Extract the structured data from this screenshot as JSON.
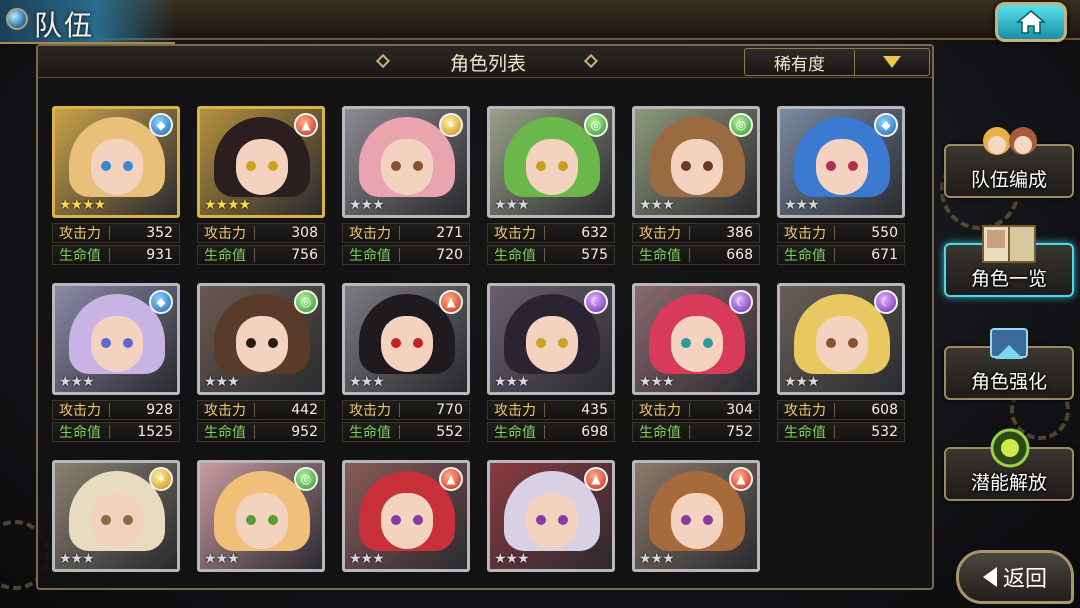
{
  "header": {
    "title": "队伍"
  },
  "panel": {
    "title": "角色列表",
    "sort_label": "稀有度"
  },
  "stat_labels": {
    "atk": "攻击力",
    "hp": "生命值"
  },
  "characters": [
    {
      "element": "water",
      "stars": "★★★★",
      "rarity": "gold",
      "atk": "352",
      "hp": "931",
      "hair": "#e8c07a",
      "bg": "#c9a24a",
      "eye": "#3a8ad0"
    },
    {
      "element": "fire",
      "stars": "★★★★",
      "rarity": "gold",
      "atk": "308",
      "hp": "756",
      "hair": "#2a1e1e",
      "bg": "#b4903e",
      "eye": "#d0a020"
    },
    {
      "element": "light",
      "stars": "★★★",
      "rarity": "silver",
      "atk": "271",
      "hp": "720",
      "hair": "#e9a4b0",
      "bg": "#8a8a90",
      "eye": "#8a5030"
    },
    {
      "element": "wind",
      "stars": "★★★",
      "rarity": "silver",
      "atk": "632",
      "hp": "575",
      "hair": "#6ab84a",
      "bg": "#9aa08a",
      "eye": "#c8a020"
    },
    {
      "element": "wind",
      "stars": "★★★",
      "rarity": "silver",
      "atk": "386",
      "hp": "668",
      "hair": "#9a6a40",
      "bg": "#8c9a7a",
      "eye": "#6a3a20"
    },
    {
      "element": "water",
      "stars": "★★★",
      "rarity": "silver",
      "atk": "550",
      "hp": "671",
      "hair": "#3a7ad0",
      "bg": "#7a8aa0",
      "eye": "#b03050"
    },
    {
      "element": "water",
      "stars": "★★★",
      "rarity": "silver",
      "atk": "928",
      "hp": "1525",
      "hair": "#c8b4e4",
      "bg": "#8a8aa8",
      "eye": "#5a6ad0"
    },
    {
      "element": "wind",
      "stars": "★★★",
      "rarity": "silver",
      "atk": "442",
      "hp": "952",
      "hair": "#5a3a28",
      "bg": "#6a5a50",
      "eye": "#2a1a10"
    },
    {
      "element": "fire",
      "stars": "★★★",
      "rarity": "silver",
      "atk": "770",
      "hp": "552",
      "hair": "#1e1a1e",
      "bg": "#7a7a80",
      "eye": "#c82020"
    },
    {
      "element": "dark",
      "stars": "★★★",
      "rarity": "silver",
      "atk": "435",
      "hp": "698",
      "hair": "#2a2430",
      "bg": "#6a6070",
      "eye": "#d0a020"
    },
    {
      "element": "dark",
      "stars": "★★★",
      "rarity": "silver",
      "atk": "304",
      "hp": "752",
      "hair": "#d83a5a",
      "bg": "#8a6a70",
      "eye": "#2a9a9a"
    },
    {
      "element": "dark",
      "stars": "★★★",
      "rarity": "silver",
      "atk": "608",
      "hp": "532",
      "hair": "#e8c860",
      "bg": "#6a6058",
      "eye": "#8a5030"
    },
    {
      "element": "light",
      "stars": "★★★",
      "rarity": "silver",
      "atk": "",
      "hp": "",
      "hair": "#e8dcc0",
      "bg": "#8a8070",
      "eye": "#8a6a40"
    },
    {
      "element": "wind",
      "stars": "★★★",
      "rarity": "silver",
      "atk": "",
      "hp": "",
      "hair": "#f0c07a",
      "bg": "#c89aa0",
      "eye": "#5a9a3a"
    },
    {
      "element": "fire",
      "stars": "★★★",
      "rarity": "silver",
      "atk": "",
      "hp": "",
      "hair": "#c8303a",
      "bg": "#8a5a5a",
      "eye": "#8a3aa0"
    },
    {
      "element": "fire",
      "stars": "★★★",
      "rarity": "silver",
      "atk": "",
      "hp": "",
      "hair": "#d8d0e4",
      "bg": "#8a3a40",
      "eye": "#8a3aa0"
    },
    {
      "element": "fire",
      "stars": "★★★",
      "rarity": "silver",
      "atk": "",
      "hp": "",
      "hair": "#a86a3a",
      "bg": "#8a7a6a",
      "eye": "#8a3aa0"
    }
  ],
  "side_menu": [
    {
      "label": "队伍编成",
      "active": false
    },
    {
      "label": "角色一览",
      "active": true
    },
    {
      "label": "角色强化",
      "active": false
    },
    {
      "label": "潜能解放",
      "active": false
    }
  ],
  "back": {
    "label": "返回"
  },
  "colors": {
    "accent_cyan": "#4fd8e8",
    "frame_gold": "#9c8a62",
    "atk_label": "#f0c86a",
    "hp_label": "#7ad35a"
  }
}
